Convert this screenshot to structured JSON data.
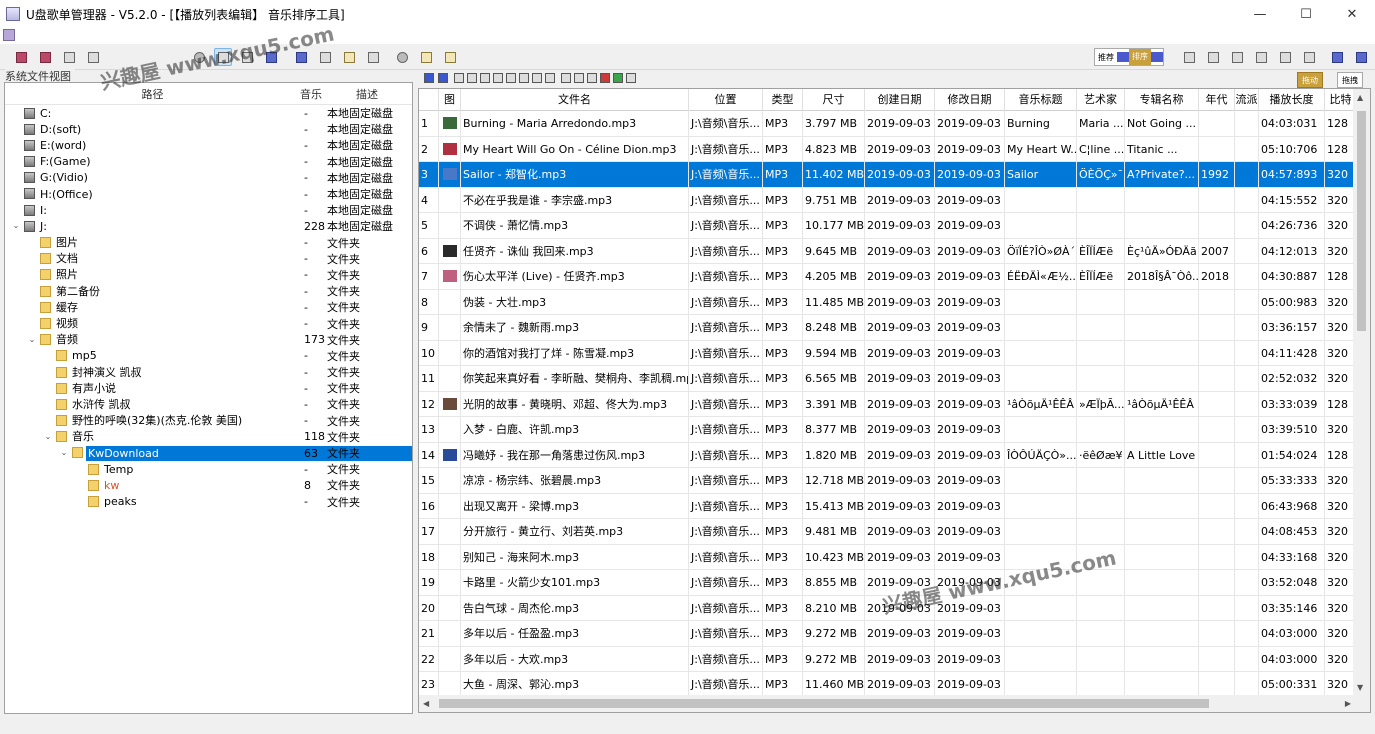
{
  "window": {
    "title": "U盘歌单管理器 - V5.2.0 - [【播放列表编辑】 音乐排序工具]",
    "minimize": "—",
    "maximize": "☐",
    "close": "✕"
  },
  "toolbar": {
    "tabs": [
      "推荐",
      "排序"
    ],
    "active_tab": "排序"
  },
  "left_panel": {
    "label": "系统文件视图",
    "headers": {
      "path": "路径",
      "music": "音乐",
      "desc": "描述"
    },
    "items": [
      {
        "level": 0,
        "name": "C:",
        "count": "-",
        "desc": "本地固定磁盘",
        "icon": "drive-icon",
        "expander": ""
      },
      {
        "level": 0,
        "name": "D:(soft)",
        "count": "-",
        "desc": "本地固定磁盘",
        "icon": "drive-icon",
        "expander": ""
      },
      {
        "level": 0,
        "name": "E:(word)",
        "count": "-",
        "desc": "本地固定磁盘",
        "icon": "drive-icon",
        "expander": ""
      },
      {
        "level": 0,
        "name": "F:(Game)",
        "count": "-",
        "desc": "本地固定磁盘",
        "icon": "drive-icon",
        "expander": ""
      },
      {
        "level": 0,
        "name": "G:(Vidio)",
        "count": "-",
        "desc": "本地固定磁盘",
        "icon": "drive-icon",
        "expander": ""
      },
      {
        "level": 0,
        "name": "H:(Office)",
        "count": "-",
        "desc": "本地固定磁盘",
        "icon": "drive-icon",
        "expander": ""
      },
      {
        "level": 0,
        "name": "I:",
        "count": "-",
        "desc": "本地固定磁盘",
        "icon": "drive-icon",
        "expander": ""
      },
      {
        "level": 0,
        "name": "J:",
        "count": "228",
        "desc": "本地固定磁盘",
        "icon": "drive-icon",
        "expander": "⌄"
      },
      {
        "level": 1,
        "name": "图片",
        "count": "-",
        "desc": "文件夹",
        "icon": "folder-icon",
        "expander": ""
      },
      {
        "level": 1,
        "name": "文档",
        "count": "-",
        "desc": "文件夹",
        "icon": "folder-icon",
        "expander": ""
      },
      {
        "level": 1,
        "name": "照片",
        "count": "-",
        "desc": "文件夹",
        "icon": "folder-icon",
        "expander": ""
      },
      {
        "level": 1,
        "name": "第二备份",
        "count": "-",
        "desc": "文件夹",
        "icon": "folder-icon",
        "expander": ""
      },
      {
        "level": 1,
        "name": "缓存",
        "count": "-",
        "desc": "文件夹",
        "icon": "folder-icon",
        "expander": ""
      },
      {
        "level": 1,
        "name": "视频",
        "count": "-",
        "desc": "文件夹",
        "icon": "folder-icon",
        "expander": ""
      },
      {
        "level": 1,
        "name": "音频",
        "count": "173",
        "desc": "文件夹",
        "icon": "folder-icon",
        "expander": "⌄"
      },
      {
        "level": 2,
        "name": "mp5",
        "count": "-",
        "desc": "文件夹",
        "icon": "folder-icon",
        "expander": ""
      },
      {
        "level": 2,
        "name": "封神演义 凯叔",
        "count": "-",
        "desc": "文件夹",
        "icon": "folder-icon",
        "expander": ""
      },
      {
        "level": 2,
        "name": "有声小说",
        "count": "-",
        "desc": "文件夹",
        "icon": "folder-icon",
        "expander": ""
      },
      {
        "level": 2,
        "name": "水浒传 凯叔",
        "count": "-",
        "desc": "文件夹",
        "icon": "folder-icon",
        "expander": ""
      },
      {
        "level": 2,
        "name": "野性的呼唤(32集)(杰克.伦敦 美国)",
        "count": "-",
        "desc": "文件夹",
        "icon": "folder-icon",
        "expander": ""
      },
      {
        "level": 2,
        "name": "音乐",
        "count": "118",
        "desc": "文件夹",
        "icon": "folder-icon",
        "expander": "⌄"
      },
      {
        "level": 3,
        "name": "KwDownload",
        "count": "63",
        "desc": "文件夹",
        "icon": "folder-icon",
        "expander": "⌄",
        "selected": true
      },
      {
        "level": 4,
        "name": "Temp",
        "count": "-",
        "desc": "文件夹",
        "icon": "folder-icon",
        "expander": ""
      },
      {
        "level": 4,
        "name": "kw",
        "count": "8",
        "desc": "文件夹",
        "icon": "folder-icon",
        "expander": "",
        "red": true
      },
      {
        "level": 4,
        "name": "peaks",
        "count": "-",
        "desc": "文件夹",
        "icon": "folder-icon",
        "expander": ""
      }
    ]
  },
  "grid": {
    "headers": [
      "",
      "图",
      "文件名",
      "位置",
      "类型",
      "尺寸",
      "创建日期",
      "修改日期",
      "音乐标题",
      "艺术家",
      "专辑名称",
      "年代",
      "流派",
      "播放长度",
      "比特"
    ],
    "rows": [
      [
        "1",
        "",
        "Burning - Maria Arredondo.mp3",
        "J:\\音频\\音乐...",
        "MP3",
        "3.797 MB",
        "2019-09-03",
        "2019-09-03",
        "Burning",
        "Maria ...",
        "Not Going ...",
        "",
        "",
        "04:03:031",
        "128"
      ],
      [
        "2",
        "",
        "My Heart Will Go On - Céline Dion.mp3",
        "J:\\音频\\音乐...",
        "MP3",
        "4.823 MB",
        "2019-09-03",
        "2019-09-03",
        "My Heart W...",
        "C¦line ...",
        "Titanic ...",
        "",
        "",
        "05:10:706",
        "128"
      ],
      [
        "3",
        "",
        "Sailor - 郑智化.mp3",
        "J:\\音频\\音乐...",
        "MP3",
        "11.402 MB",
        "2019-09-03",
        "2019-09-03",
        "Sailor",
        "ÖÈÖÇ»¯",
        "A?Private?...",
        "1992",
        "",
        "04:57:893",
        "320"
      ],
      [
        "4",
        "",
        "不必在乎我是谁 - 李宗盛.mp3",
        "J:\\音频\\音乐...",
        "MP3",
        "9.751 MB",
        "2019-09-03",
        "2019-09-03",
        "",
        "",
        "",
        "",
        "",
        "04:15:552",
        "320"
      ],
      [
        "5",
        "",
        "不调侠 - 萧忆情.mp3",
        "J:\\音频\\音乐...",
        "MP3",
        "10.177 MB",
        "2019-09-03",
        "2019-09-03",
        "",
        "",
        "",
        "",
        "",
        "04:26:736",
        "320"
      ],
      [
        "6",
        "",
        "任贤齐 - 诛仙 我回来.mp3",
        "J:\\音频\\音乐...",
        "MP3",
        "9.645 MB",
        "2019-09-03",
        "2019-09-03",
        "ÖïÏÉ?ÎÒ»ØÀ´",
        "ÈÎÏÍÆë",
        "Èç¹ûÄ»ÓÐÄã",
        "2007",
        "",
        "04:12:013",
        "320"
      ],
      [
        "7",
        "",
        "伤心太平洋 (Live) - 任贤齐.mp3",
        "J:\\音频\\音乐...",
        "MP3",
        "4.205 MB",
        "2019-09-03",
        "2019-09-03",
        "ÉËÐÄÌ«Æ½...",
        "ÈÎÏÍÆë",
        "2018Î§Â¯Òô...",
        "2018",
        "",
        "04:30:887",
        "128"
      ],
      [
        "8",
        "",
        "伪装 - 大壮.mp3",
        "J:\\音频\\音乐...",
        "MP3",
        "11.485 MB",
        "2019-09-03",
        "2019-09-03",
        "",
        "",
        "",
        "",
        "",
        "05:00:983",
        "320"
      ],
      [
        "9",
        "",
        "余情未了 - 魏新雨.mp3",
        "J:\\音频\\音乐...",
        "MP3",
        "8.248 MB",
        "2019-09-03",
        "2019-09-03",
        "",
        "",
        "",
        "",
        "",
        "03:36:157",
        "320"
      ],
      [
        "10",
        "",
        "你的酒馆对我打了烊 - 陈雪凝.mp3",
        "J:\\音频\\音乐...",
        "MP3",
        "9.594 MB",
        "2019-09-03",
        "2019-09-03",
        "",
        "",
        "",
        "",
        "",
        "04:11:428",
        "320"
      ],
      [
        "11",
        "",
        "你笑起来真好看 - 李昕融、樊桐舟、李凯稠.mp3",
        "J:\\音频\\音乐...",
        "MP3",
        "6.565 MB",
        "2019-09-03",
        "2019-09-03",
        "",
        "",
        "",
        "",
        "",
        "02:52:032",
        "320"
      ],
      [
        "12",
        "",
        "光阴的故事 - 黄晓明、邓超、佟大为.mp3",
        "J:\\音频\\音乐...",
        "MP3",
        "3.391 MB",
        "2019-09-03",
        "2019-09-03",
        "¹âÒõµÄ¹ÊÊÂ",
        "»ÆÏþÃ...",
        "¹âÒõµÄ¹ÊÊÂ",
        "",
        "",
        "03:33:039",
        "128"
      ],
      [
        "13",
        "",
        "入梦 - 白鹿、许凯.mp3",
        "J:\\音频\\音乐...",
        "MP3",
        "8.377 MB",
        "2019-09-03",
        "2019-09-03",
        "",
        "",
        "",
        "",
        "",
        "03:39:510",
        "320"
      ],
      [
        "14",
        "",
        "冯曦妤 - 我在那一角落患过伤风.mp3",
        "J:\\音频\\音乐...",
        "MP3",
        "1.820 MB",
        "2019-09-03",
        "2019-09-03",
        "ÎÒÔÚÄÇÒ»...",
        "·ëêØæ¥",
        "A Little Love",
        "",
        "",
        "01:54:024",
        "128"
      ],
      [
        "15",
        "",
        "凉凉 - 杨宗纬、张碧晨.mp3",
        "J:\\音频\\音乐...",
        "MP3",
        "12.718 MB",
        "2019-09-03",
        "2019-09-03",
        "",
        "",
        "",
        "",
        "",
        "05:33:333",
        "320"
      ],
      [
        "16",
        "",
        "出现又离开 - 梁博.mp3",
        "J:\\音频\\音乐...",
        "MP3",
        "15.413 MB",
        "2019-09-03",
        "2019-09-03",
        "",
        "",
        "",
        "",
        "",
        "06:43:968",
        "320"
      ],
      [
        "17",
        "",
        "分开旅行 - 黄立行、刘若英.mp3",
        "J:\\音频\\音乐...",
        "MP3",
        "9.481 MB",
        "2019-09-03",
        "2019-09-03",
        "",
        "",
        "",
        "",
        "",
        "04:08:453",
        "320"
      ],
      [
        "18",
        "",
        "别知己 - 海来阿木.mp3",
        "J:\\音频\\音乐...",
        "MP3",
        "10.423 MB",
        "2019-09-03",
        "2019-09-03",
        "",
        "",
        "",
        "",
        "",
        "04:33:168",
        "320"
      ],
      [
        "19",
        "",
        "卡路里 - 火箭少女101.mp3",
        "J:\\音频\\音乐...",
        "MP3",
        "8.855 MB",
        "2019-09-03",
        "2019-09-03",
        "",
        "",
        "",
        "",
        "",
        "03:52:048",
        "320"
      ],
      [
        "20",
        "",
        "告白气球 - 周杰伦.mp3",
        "J:\\音频\\音乐...",
        "MP3",
        "8.210 MB",
        "2019-09-03",
        "2019-09-03",
        "",
        "",
        "",
        "",
        "",
        "03:35:146",
        "320"
      ],
      [
        "21",
        "",
        "多年以后 - 任盈盈.mp3",
        "J:\\音频\\音乐...",
        "MP3",
        "9.272 MB",
        "2019-09-03",
        "2019-09-03",
        "",
        "",
        "",
        "",
        "",
        "04:03:000",
        "320"
      ],
      [
        "22",
        "",
        "多年以后 - 大欢.mp3",
        "J:\\音频\\音乐...",
        "MP3",
        "9.272 MB",
        "2019-09-03",
        "2019-09-03",
        "",
        "",
        "",
        "",
        "",
        "04:03:000",
        "320"
      ],
      [
        "23",
        "",
        "大鱼 - 周深、郭沁.mp3",
        "J:\\音频\\音乐...",
        "MP3",
        "11.460 MB",
        "2019-09-03",
        "2019-09-03",
        "",
        "",
        "",
        "",
        "",
        "05:00:331",
        "320"
      ]
    ],
    "selected_index": 2,
    "thumb_rows": [
      0,
      1,
      2,
      5,
      6,
      11,
      13
    ],
    "thumb_colors": [
      "#3a6a3a",
      "#b03040",
      "#4a78c8",
      "#2a2a2a",
      "#c06080",
      "#6a4a3a",
      "#2a4a9a"
    ]
  },
  "right_strip": {
    "left_button": "拖动",
    "right_button": "拖拽"
  },
  "watermark": "兴趣屋 www.xqu5.com"
}
